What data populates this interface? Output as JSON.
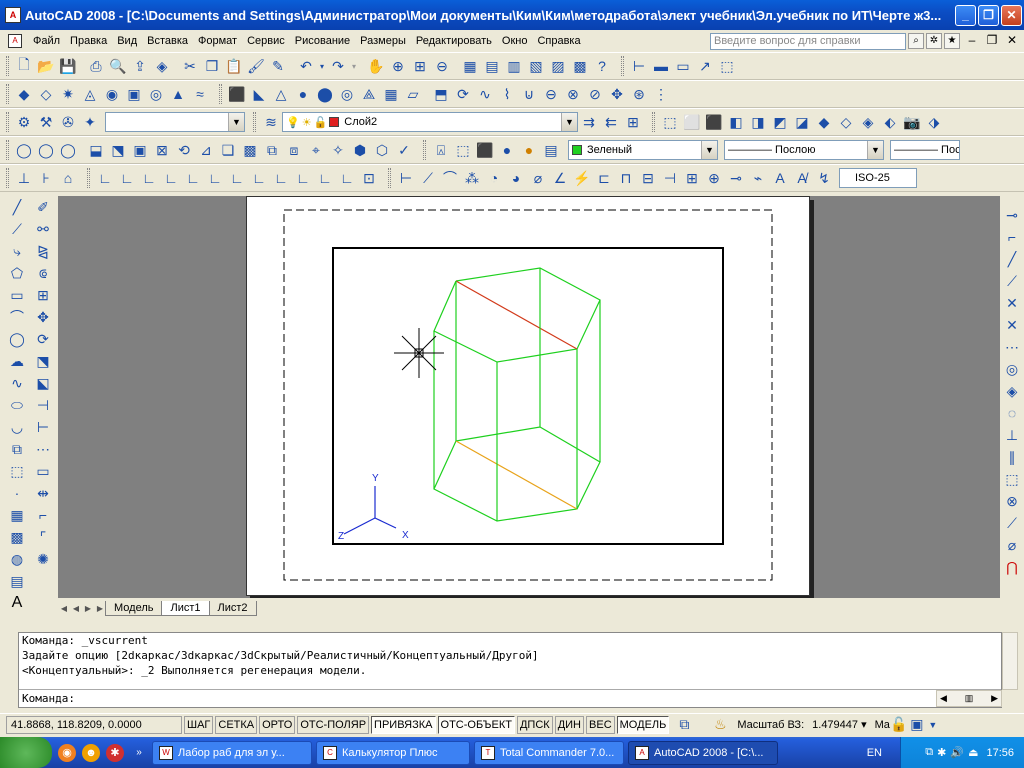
{
  "window": {
    "title": "AutoCAD 2008 - [C:\\Documents and Settings\\Администратор\\Мои документы\\Ким\\Ким\\методработа\\элект учебник\\Эл.учебник по ИТ\\Черте ж3...",
    "app_icon": "A",
    "minimize": "_",
    "restore": "❐",
    "close": "✕"
  },
  "menubar": {
    "items": [
      "Файл",
      "Правка",
      "Вид",
      "Вставка",
      "Формат",
      "Сервис",
      "Рисование",
      "Размеры",
      "Редактировать",
      "Окно",
      "Справка"
    ],
    "help_placeholder": "Введите вопрос для справки",
    "mdi_minimize": "–",
    "mdi_restore": "❐",
    "mdi_close": "✕"
  },
  "toolbars": {
    "layer_name": "Слой2",
    "color_name": "Зеленый",
    "linetype": "———— Послою",
    "lineweight": "———— Пос.",
    "dimstyle": "ISO-25"
  },
  "drawing": {
    "ucs_x": "X",
    "ucs_y": "Y",
    "ucs_z": "Z"
  },
  "tabs": {
    "nav": [
      "◀",
      "◀",
      "▶",
      "▶"
    ],
    "items": [
      "Модель",
      "Лист1",
      "Лист2"
    ],
    "active": "Лист1"
  },
  "command": {
    "history": [
      "Команда:  _vscurrent",
      "Задайте опцию [2dкаркас/3dкаркас/3dСкрытый/Реалистичный/Концептуальный/Другой]",
      "<Концептуальный>: _2 Выполняется регенерация модели."
    ],
    "prompt": "Команда:"
  },
  "statusbar": {
    "coords": "41.8868, 118.8209, 0.0000",
    "toggles": [
      "ШАГ",
      "СЕТКА",
      "ОРТО",
      "ОТС-ПОЛЯР",
      "ПРИВЯЗКА",
      "ОТС-ОБЪЕКТ",
      "ДПСК",
      "ДИН",
      "ВЕС",
      "МОДЕЛЬ"
    ],
    "active_toggles": [
      "ПРИВЯЗКА",
      "ОТС-ОБЪЕКТ",
      "МОДЕЛЬ"
    ],
    "scale_label": "Масштаб ВЗ:",
    "scale_value": "1.479447 ▾",
    "extra": "Ma"
  },
  "taskbar": {
    "buttons": [
      {
        "label": "Лабор  раб для эл у...",
        "active": false
      },
      {
        "label": "Калькулятор Плюс",
        "active": false
      },
      {
        "label": "Total Commander 7.0...",
        "active": false
      },
      {
        "label": "AutoCAD 2008 - [C:\\...",
        "active": true
      }
    ],
    "language": "EN",
    "clock": "17:56"
  },
  "colors": {
    "titlebar": "#0b4dc4",
    "line_green": "#1ed01e",
    "line_red": "#d23a1a",
    "line_orange": "#e8a31a",
    "ucs_blue": "#1a2bd0"
  }
}
